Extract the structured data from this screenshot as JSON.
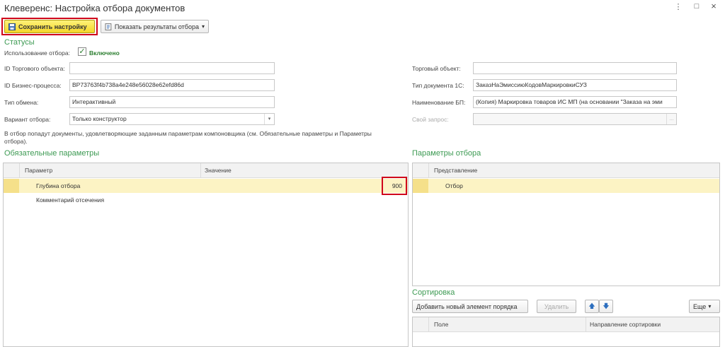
{
  "window": {
    "title": "Клеверенс: Настройка отбора документов",
    "menu_glyph": "⋮",
    "restore_glyph": "□",
    "close_glyph": "×"
  },
  "toolbar": {
    "save_label": "Сохранить настройку",
    "show_results_label": "Показать результаты отбора",
    "show_results_arrow": "▾"
  },
  "statuses": {
    "section_title": "Статусы",
    "usage_label": "Использование отбора:",
    "usage_check": "✓",
    "usage_value": "Включено"
  },
  "left_fields": [
    {
      "label": "ID Торгового объекта:",
      "value": ""
    },
    {
      "label": "ID Бизнес-процесса:",
      "value": "BP73763f4b738a4e248e56028e62efd86d"
    },
    {
      "label": "Тип обмена:",
      "value": "Интерактивный"
    },
    {
      "label": "Вариант отбора:",
      "value": "Только конструктор",
      "dropdown": "▾"
    }
  ],
  "right_fields": [
    {
      "label": "Торговый объект:",
      "value": ""
    },
    {
      "label": "Тип документа 1С:",
      "value": "ЗаказНаЭмиссиюКодовМаркировкиСУЗ"
    },
    {
      "label": "Наименование БП:",
      "value": "(Копия) Маркировка товаров ИС МП (на основании \"Заказа на эми"
    },
    {
      "label": "Свой запрос:",
      "value": "",
      "button": "..."
    }
  ],
  "info_text_line1": "В отбор попадут документы, удовлетворяющие заданным параметрам компоновщика (см. Обязательные параметры и Параметры",
  "info_text_line2": "отбора).",
  "required_params": {
    "section_title": "Обязательные параметры",
    "columns": [
      "Параметр",
      "Значение"
    ],
    "rows": [
      {
        "name": "Глубина отбора",
        "value": "900"
      },
      {
        "name": "Комментарий отсечения",
        "value": ""
      }
    ]
  },
  "filter_params": {
    "section_title": "Параметры отбора",
    "column": "Представление",
    "rows": [
      {
        "name": "Отбор"
      }
    ]
  },
  "sorting": {
    "section_title": "Сортировка",
    "add_label": "Добавить новый элемент порядка",
    "delete_label": "Удалить",
    "up_glyph": "🡅",
    "down_glyph": "🡇",
    "more_label": "Еще",
    "more_arrow": "▾",
    "columns": [
      "Поле",
      "Направление сортировки"
    ]
  }
}
